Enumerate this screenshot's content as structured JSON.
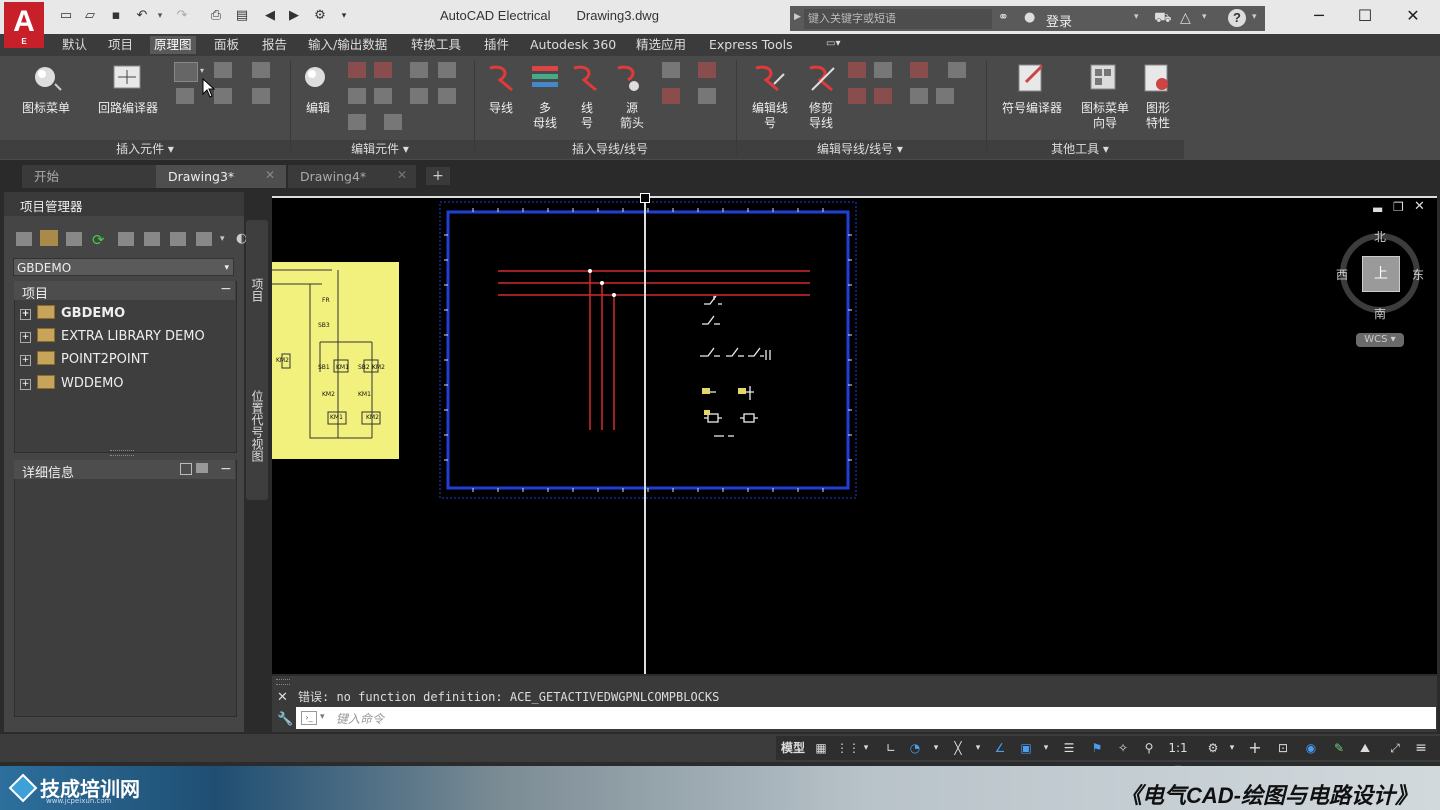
{
  "titlebar": {
    "app_name": "AutoCAD Electrical",
    "file_name": "Drawing3.dwg",
    "search_placeholder": "键入关键字或短语",
    "login_label": "登录",
    "logo_letter": "A",
    "logo_sub": "E"
  },
  "menu_tabs": [
    "默认",
    "项目",
    "原理图",
    "面板",
    "报告",
    "输入/输出数据",
    "转换工具",
    "插件",
    "Autodesk 360",
    "精选应用",
    "Express Tools"
  ],
  "ribbon": {
    "icon_menu": "图标菜单",
    "circuit_builder": "回路编译器",
    "edit": "编辑",
    "wire": "导线",
    "multi_bus_1": "多",
    "multi_bus_2": "母线",
    "wire_num_1": "线",
    "wire_num_2": "号",
    "source_arrow_1": "源",
    "source_arrow_2": "箭头",
    "edit_wire_num_1": "编辑线",
    "edit_wire_num_2": "号",
    "trim_wire_1": "修剪",
    "trim_wire_2": "导线",
    "symbol_builder": "符号编译器",
    "icon_menu_wizard_1": "图标菜单",
    "icon_menu_wizard_2": "向导",
    "graphic_props_1": "图形",
    "graphic_props_2": "特性",
    "panels": [
      "插入元件",
      "编辑元件",
      "插入导线/线号",
      "编辑导线/线号",
      "其他工具"
    ]
  },
  "doc_tabs": [
    "开始",
    "Drawing3*",
    "Drawing4*"
  ],
  "project_manager": {
    "title": "项目管理器",
    "current_project": "GBDEMO",
    "tree_header": "项目",
    "projects": [
      "GBDEMO",
      "EXTRA LIBRARY DEMO",
      "POINT2POINT",
      "WDDEMO"
    ],
    "detail_header": "详细信息",
    "side_tab_project": "项目",
    "side_tab_location": "位置代号视图"
  },
  "viewcube": {
    "north": "北",
    "south": "南",
    "east": "东",
    "west": "西",
    "top": "上",
    "wcs": "WCS"
  },
  "command": {
    "output": "错误: no function definition: ACE_GETACTIVEDWGPNLCOMPBLOCKS",
    "placeholder": "键入命令"
  },
  "statusbar": {
    "model": "模型",
    "scale": "1:1"
  },
  "schematic_labels": [
    "FR",
    "SB3",
    "SB1",
    "KM1",
    "SB2",
    "KM2",
    "KM2",
    "KM1",
    "KM1",
    "KM2",
    "KM2"
  ],
  "footer": {
    "brand": "技成培训网",
    "brand_url": "www.jcpeixun.com",
    "course_title": "《电气CAD-绘图与电路设计》"
  }
}
